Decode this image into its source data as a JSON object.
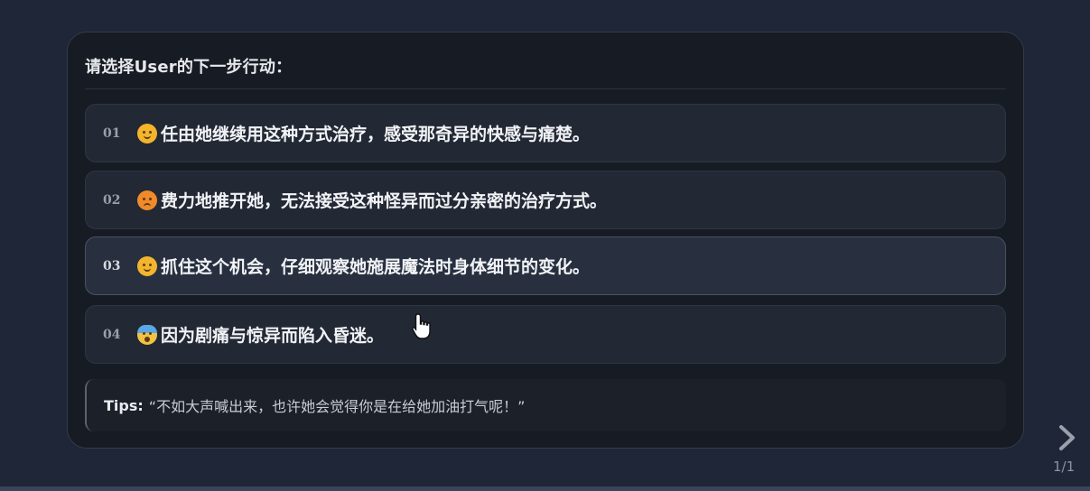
{
  "panel": {
    "title": "请选择User的下一步行动："
  },
  "options": [
    {
      "num": "01",
      "icon": "smirk-face-icon",
      "text": "任由她继续用这种方式治疗，感受那奇异的快感与痛楚。"
    },
    {
      "num": "02",
      "icon": "angry-face-icon",
      "text": "费力地推开她，无法接受这种怪异而过分亲密的治疗方式。"
    },
    {
      "num": "03",
      "icon": "thinking-face-icon",
      "text": "抓住这个机会，仔细观察她施展魔法时身体细节的变化。"
    },
    {
      "num": "04",
      "icon": "fearful-face-icon",
      "text": "因为剧痛与惊异而陷入昏迷。"
    }
  ],
  "tips": {
    "label": "Tips:",
    "text": "“不如大声喊出来，也许她会觉得你是在给她加油打气呢！”"
  },
  "pagination": {
    "icon": "chevron-right-icon",
    "count": "1/1"
  },
  "colors": {
    "background": "#1e2638",
    "panel": "#161b24",
    "option": "#222834",
    "accent_emoji": "#f3b52c"
  }
}
